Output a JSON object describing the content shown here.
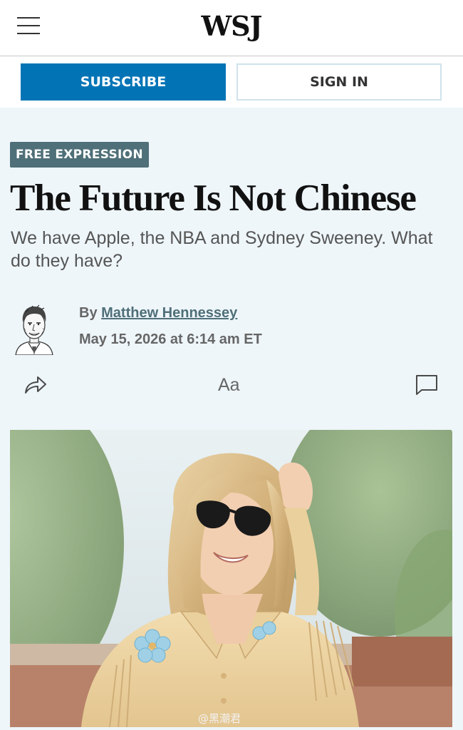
{
  "header": {
    "logo": "WSJ",
    "subscribe_label": "SUBSCRIBE",
    "signin_label": "SIGN IN"
  },
  "article": {
    "section_badge": "FREE EXPRESSION",
    "headline": "The Future Is Not Chinese",
    "dek": "We have Apple, the NBA and Sydney Sweeney. What do they have?",
    "byline_prefix": "By ",
    "author": "Matthew Hennessey",
    "date": "May 15, 2026 at 6:14 am ET"
  },
  "tools": {
    "text_size_label": "Aa"
  },
  "watermark": "@黑潮君",
  "icons": {
    "menu": "hamburger-menu-icon",
    "share": "share-icon",
    "text_size": "text-size-icon",
    "comment": "comment-icon"
  },
  "colors": {
    "subscribe_bg": "#0274b6",
    "badge_bg": "#4f6f79",
    "page_bg": "#eef6fa"
  }
}
